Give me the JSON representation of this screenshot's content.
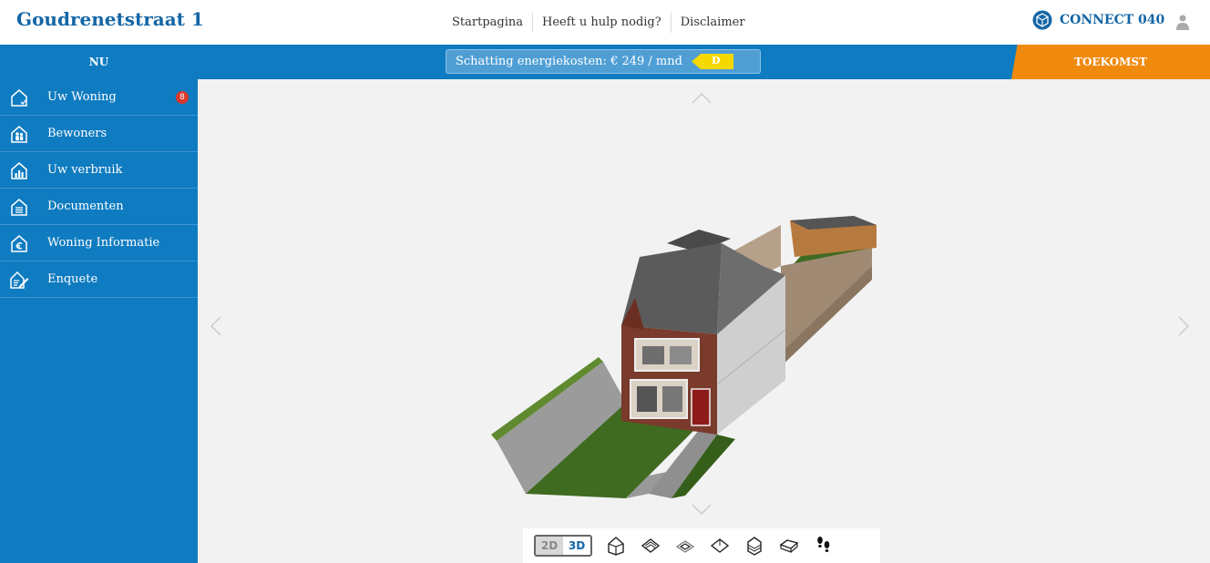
{
  "header": {
    "title": "Goudrenetstraat 1",
    "nav": [
      "Startpagina",
      "Heeft u hulp nodig?",
      "Disclaimer"
    ],
    "brand": "CONNECT 040"
  },
  "bar": {
    "nu_label": "NU",
    "estimate_text": "Schatting energiekosten: € 249 / mnd",
    "energy_label": "D",
    "toekomst_label": "TOEKOMST"
  },
  "sidebar": {
    "items": [
      {
        "label": "Uw Woning",
        "icon": "house-outline-icon",
        "badge": "8"
      },
      {
        "label": "Bewoners",
        "icon": "house-people-icon"
      },
      {
        "label": "Uw verbruik",
        "icon": "house-chart-icon"
      },
      {
        "label": "Documenten",
        "icon": "house-document-icon"
      },
      {
        "label": "Woning Informatie",
        "icon": "house-euro-icon"
      },
      {
        "label": "Enquete",
        "icon": "survey-pen-icon"
      }
    ]
  },
  "toolbar": {
    "btn_2d": "2D",
    "btn_3d": "3D",
    "active_mode": "3D"
  },
  "colors": {
    "primary": "#0f7bc0",
    "accent_orange": "#f08a0f",
    "energy_label_yellow": "#f5d800",
    "title_blue": "#1466a6",
    "badge_red": "#d9372b"
  }
}
